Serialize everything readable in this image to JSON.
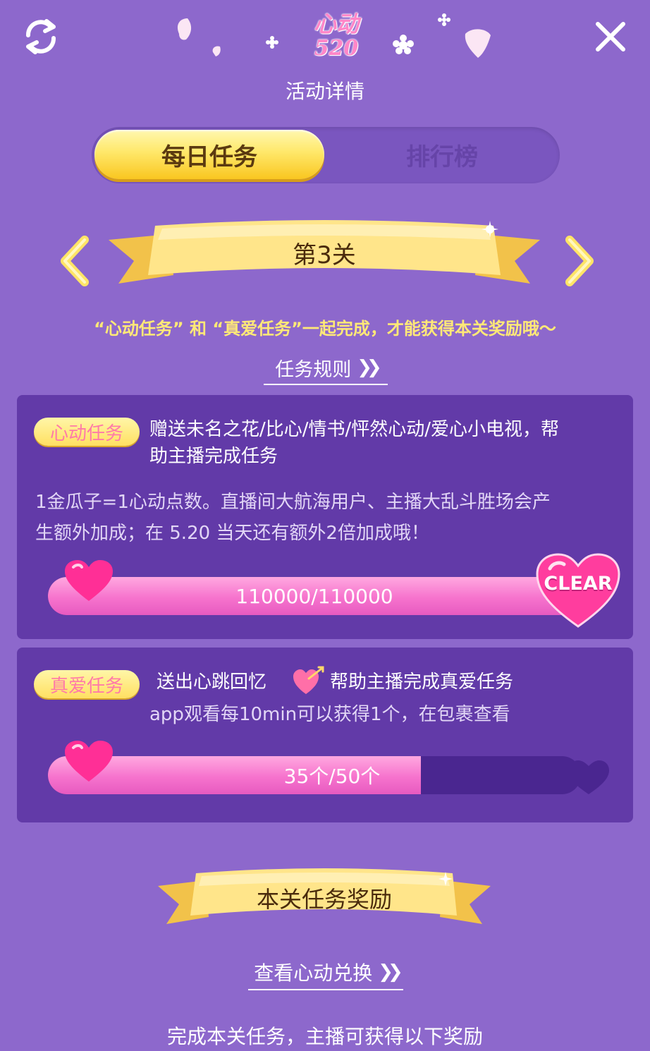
{
  "header": {
    "logo_top": "心动",
    "logo_bottom": "520",
    "title": "活动详情"
  },
  "tabs": [
    {
      "label": "每日任务",
      "active": true
    },
    {
      "label": "排行榜",
      "active": false
    }
  ],
  "level": {
    "label": "第3关"
  },
  "notice": "“心动任务” 和 “真爱任务”一起完成，才能获得本关奖励哦～",
  "rules_link": "任务规则",
  "tasks": [
    {
      "badge": "心动任务",
      "description_line1": "赠送未名之花/比心/情书/怦然心动/爱心小电视，帮",
      "description_line2": "助主播完成任务",
      "detail_line1": "1金瓜子=1心动点数。直播间大航海用户、主播大乱斗胜场会产",
      "detail_line2": "生额外加成；在 5.20 当天还有额外2倍加成哦！",
      "progress_text": "110000/110000",
      "progress_fraction": 1.0,
      "clear_label": "CLEAR"
    },
    {
      "badge": "真爱任务",
      "description_part1": "送出心跳回忆",
      "description_part2": "帮助主播完成真爱任务",
      "detail": "app观看每10min可以获得1个，在包裹查看",
      "progress_text": "35个/50个",
      "progress_fraction": 0.7
    }
  ],
  "reward": {
    "title": "本关任务奖励",
    "exchange_link": "查看心动兑换"
  },
  "footer": "完成本关任务，主播可获得以下奖励",
  "colors": {
    "background": "#8d68cc",
    "card": "#623aa8",
    "gold": "#ffe062",
    "pink": "#f673cd",
    "notice": "#ffe977"
  }
}
